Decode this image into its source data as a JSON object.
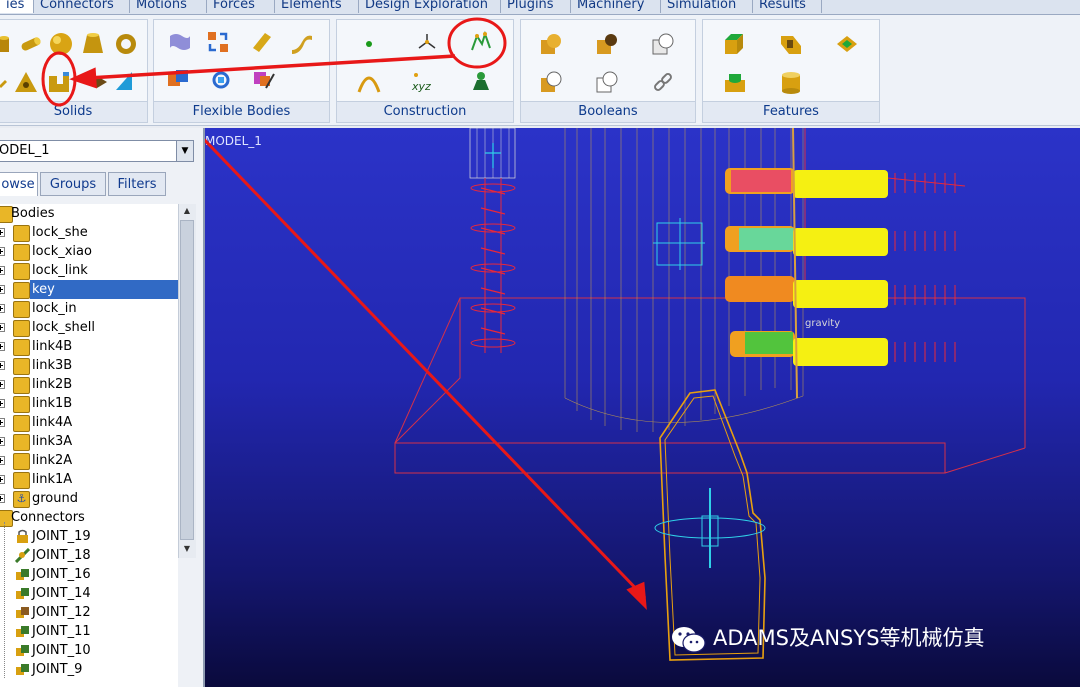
{
  "tabs": [
    {
      "label": "ies",
      "active": true
    },
    {
      "label": "Connectors"
    },
    {
      "label": "Motions"
    },
    {
      "label": "Forces"
    },
    {
      "label": "Elements"
    },
    {
      "label": "Design Exploration"
    },
    {
      "label": "Plugins"
    },
    {
      "label": "Machinery"
    },
    {
      "label": "Simulation"
    },
    {
      "label": "Results"
    }
  ],
  "ribbon": {
    "groups": [
      {
        "label": "Solids",
        "icons": [
          "cylinder-solid-icon",
          "link-solid-icon",
          "sphere-solid-icon",
          "frustum-solid-icon",
          "torus-solid-icon",
          "plate-solid-icon",
          "triangle-solid-icon",
          "extrusion-solid-icon",
          "box-solid-icon",
          "arrow-solid-icon"
        ]
      },
      {
        "label": "Flexible Bodies",
        "icons": [
          "flex-sheet-icon",
          "flex-swap-icon",
          "flex-beam-icon",
          "flex-curve-icon",
          "flex-box-icon",
          "flex-rotate-icon",
          "flex-edit-icon"
        ]
      },
      {
        "label": "Construction",
        "icons": [
          "point-icon",
          "marker-icon",
          "polyline-icon",
          "arc-icon",
          "xyz-coords-icon",
          "bell-curve-icon"
        ]
      },
      {
        "label": "Booleans",
        "icons": [
          "union-icon",
          "merge-icon",
          "cut-icon",
          "intersect-icon",
          "split-icon",
          "chain-icon"
        ]
      },
      {
        "label": "Features",
        "icons": [
          "chamfer-icon",
          "hole-icon",
          "boss-icon",
          "shell-icon",
          "cylinder-feature-icon"
        ]
      }
    ],
    "colors": {
      "accent": "#0d3a8c",
      "highlight_circle": "#e81818"
    }
  },
  "panel": {
    "model_select": "ODEL_1",
    "tabs": [
      "owse",
      "Groups",
      "Filters"
    ],
    "tree": [
      {
        "label": "Bodies",
        "type": "folder",
        "expanded": true
      },
      {
        "label": "lock_she",
        "type": "body"
      },
      {
        "label": "lock_xiao",
        "type": "body"
      },
      {
        "label": "lock_link",
        "type": "body"
      },
      {
        "label": "key",
        "type": "body",
        "selected": true
      },
      {
        "label": "lock_in",
        "type": "body"
      },
      {
        "label": "lock_shell",
        "type": "body"
      },
      {
        "label": "link4B",
        "type": "body"
      },
      {
        "label": "link3B",
        "type": "body"
      },
      {
        "label": "link2B",
        "type": "body"
      },
      {
        "label": "link1B",
        "type": "body"
      },
      {
        "label": "link4A",
        "type": "body"
      },
      {
        "label": "link3A",
        "type": "body"
      },
      {
        "label": "link2A",
        "type": "body"
      },
      {
        "label": "link1A",
        "type": "body"
      },
      {
        "label": "ground",
        "type": "ground"
      },
      {
        "label": "Connectors",
        "type": "folder",
        "expanded": true
      },
      {
        "label": "JOINT_19",
        "type": "joint-lock"
      },
      {
        "label": "JOINT_18",
        "type": "joint"
      },
      {
        "label": "JOINT_16",
        "type": "joint"
      },
      {
        "label": "JOINT_14",
        "type": "joint"
      },
      {
        "label": "JOINT_12",
        "type": "joint"
      },
      {
        "label": "JOINT_11",
        "type": "joint"
      },
      {
        "label": "JOINT_10",
        "type": "joint"
      },
      {
        "label": "JOINT_9",
        "type": "joint"
      }
    ]
  },
  "viewport": {
    "title": "MODEL_1",
    "gravity_label": "gravity",
    "watermark": "ADAMS及ANSYS等机械仿真"
  }
}
